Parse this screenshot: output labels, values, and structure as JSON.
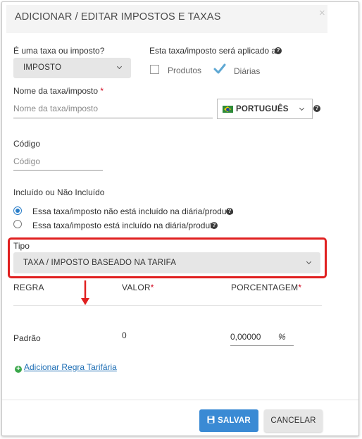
{
  "modal": {
    "title": "ADICIONAR / EDITAR IMPOSTOS E TAXAS",
    "close_symbol": "×"
  },
  "tax_or_fee": {
    "label": "É uma taxa ou imposto?",
    "value": "IMPOSTO"
  },
  "applied_to": {
    "label": "Esta taxa/imposto será aplicado a",
    "options": [
      {
        "label": "Produtos",
        "checked": false
      },
      {
        "label": "Diárias",
        "checked": true
      }
    ]
  },
  "name": {
    "label": "Nome da taxa/imposto",
    "required_mark": "*",
    "placeholder": "Nome da taxa/imposto",
    "value": ""
  },
  "language": {
    "value": "PORTUGUÊS",
    "flag_icon": "brazil-flag-icon"
  },
  "code": {
    "label": "Código",
    "placeholder": "Código",
    "value": ""
  },
  "included": {
    "label": "Incluído ou Não Incluído",
    "options": [
      {
        "label": "Essa taxa/imposto não está incluído na diária/produto",
        "selected": true
      },
      {
        "label": "Essa taxa/imposto está incluído na diária/produto",
        "selected": false
      }
    ]
  },
  "type": {
    "label": "Tipo",
    "value": "TAXA / IMPOSTO BASEADO NA TARIFA"
  },
  "rules_table": {
    "headers": {
      "rule": "REGRA",
      "value": "VALOR",
      "percentage": "PORCENTAGEM",
      "required_mark": "*"
    },
    "rows": [
      {
        "rule": "Padrão",
        "value": "0",
        "percentage": "0,00000",
        "unit": "%"
      }
    ]
  },
  "add_rule_link": "Adicionar Regra Tarifária",
  "footer": {
    "save_label": "SALVAR",
    "cancel_label": "CANCELAR"
  },
  "colors": {
    "primary": "#3a8ad4",
    "highlight": "#e02020",
    "required": "#d0021b",
    "link": "#1f6fb5"
  }
}
